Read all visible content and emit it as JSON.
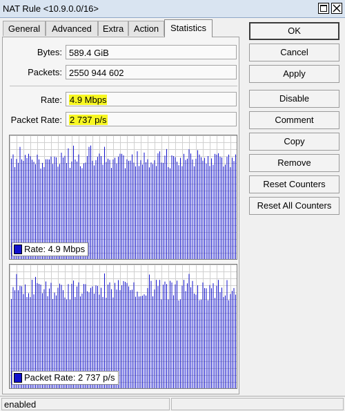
{
  "window": {
    "title": "NAT Rule <10.9.0.0/16>"
  },
  "tabs": [
    {
      "label": "General"
    },
    {
      "label": "Advanced"
    },
    {
      "label": "Extra"
    },
    {
      "label": "Action"
    },
    {
      "label": "Statistics",
      "active": true
    }
  ],
  "stats": {
    "bytes_label": "Bytes:",
    "bytes_value": "589.4 GiB",
    "packets_label": "Packets:",
    "packets_value": "2550 944 602",
    "rate_label": "Rate:",
    "rate_value": "4.9 Mbps",
    "packet_rate_label": "Packet Rate:",
    "packet_rate_value": "2 737 p/s"
  },
  "graphs": {
    "rate_legend": "Rate:  4.9 Mbps",
    "packet_rate_legend": "Packet Rate:  2 737 p/s",
    "bar_color": "#1010cc"
  },
  "buttons": {
    "ok": "OK",
    "cancel": "Cancel",
    "apply": "Apply",
    "disable": "Disable",
    "comment": "Comment",
    "copy": "Copy",
    "remove": "Remove",
    "reset_counters": "Reset Counters",
    "reset_all_counters": "Reset All Counters"
  },
  "status": {
    "text": "enabled"
  },
  "colors": {
    "highlight": "#f7f722",
    "titlebar": "#d9e4f1"
  }
}
